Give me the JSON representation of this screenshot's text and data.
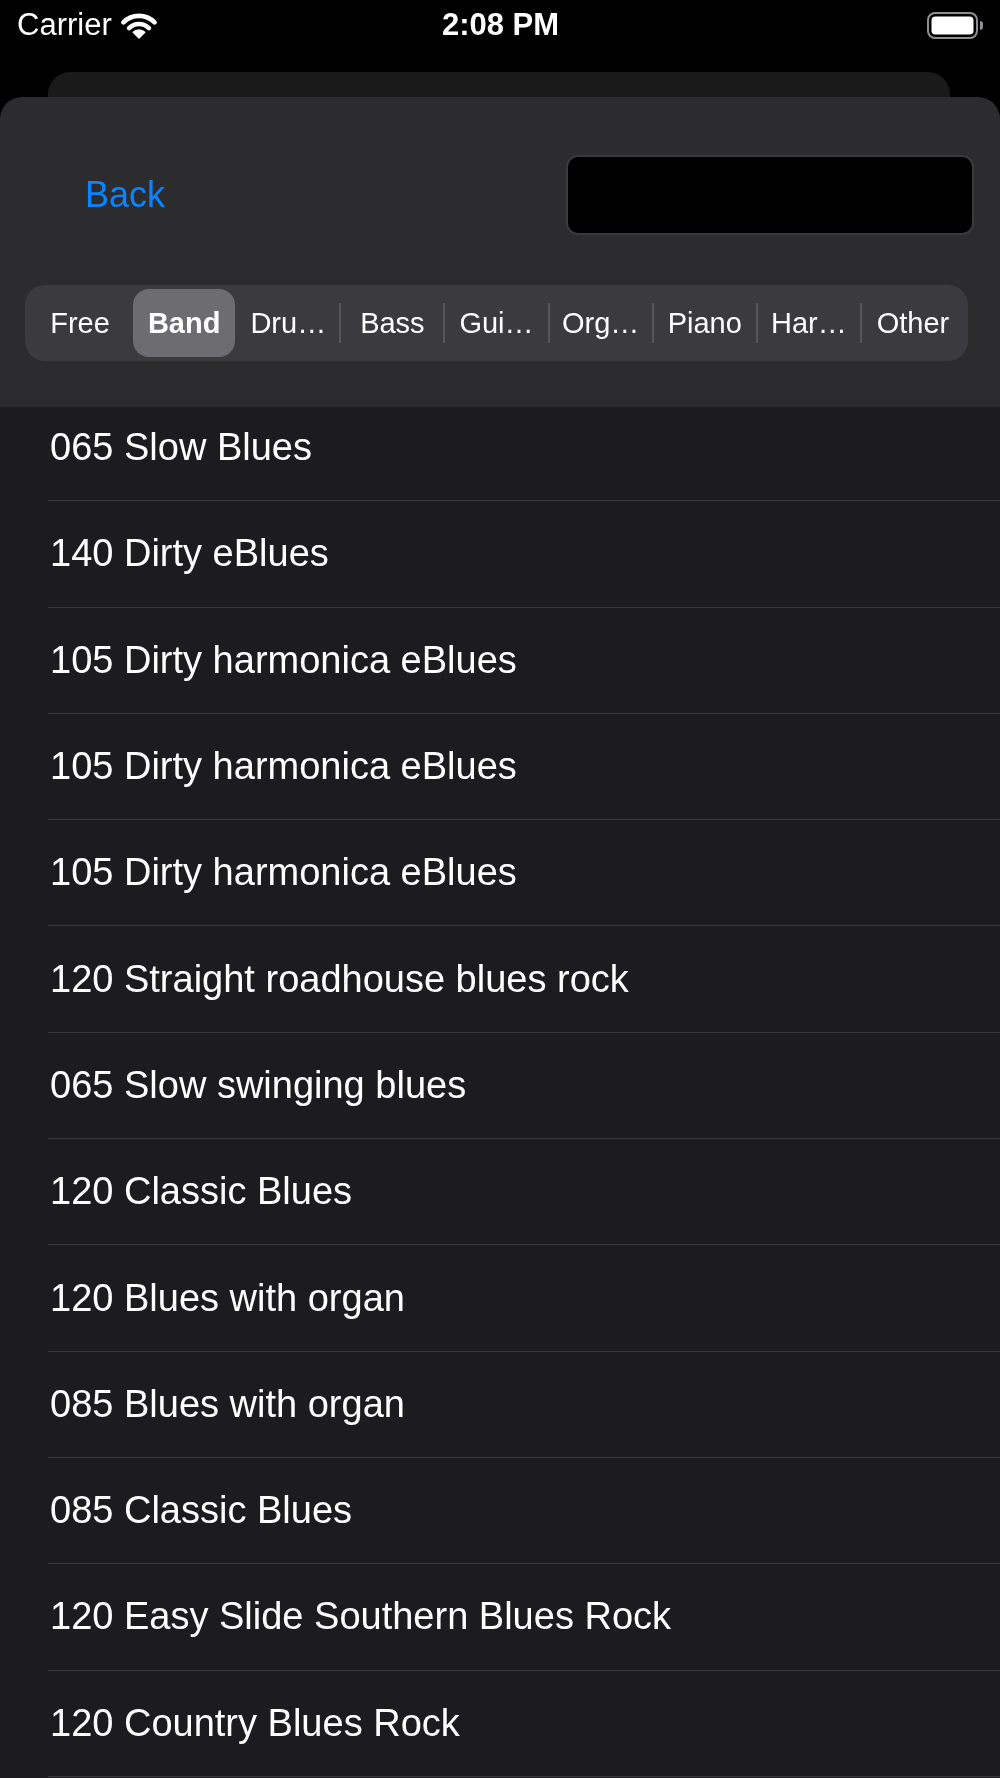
{
  "status_bar": {
    "carrier": "Carrier",
    "time": "2:08 PM"
  },
  "header": {
    "back_button": "Back"
  },
  "segments": [
    {
      "label": "Free",
      "selected": false
    },
    {
      "label": "Band",
      "selected": true
    },
    {
      "label": "Dru…",
      "selected": false
    },
    {
      "label": "Bass",
      "selected": false
    },
    {
      "label": "Gui…",
      "selected": false
    },
    {
      "label": "Org…",
      "selected": false
    },
    {
      "label": "Piano",
      "selected": false
    },
    {
      "label": "Har…",
      "selected": false
    },
    {
      "label": "Other",
      "selected": false
    }
  ],
  "rows": [
    "065 Slow Blues",
    "140 Dirty eBlues",
    "105 Dirty harmonica eBlues",
    "105 Dirty harmonica eBlues",
    "105 Dirty harmonica eBlues",
    "120 Straight roadhouse blues rock",
    "065 Slow swinging blues",
    "120 Classic Blues",
    "120 Blues with organ",
    "085 Blues with organ",
    "085 Classic Blues",
    "120 Easy Slide Southern Blues Rock",
    "120 Country Blues Rock"
  ]
}
